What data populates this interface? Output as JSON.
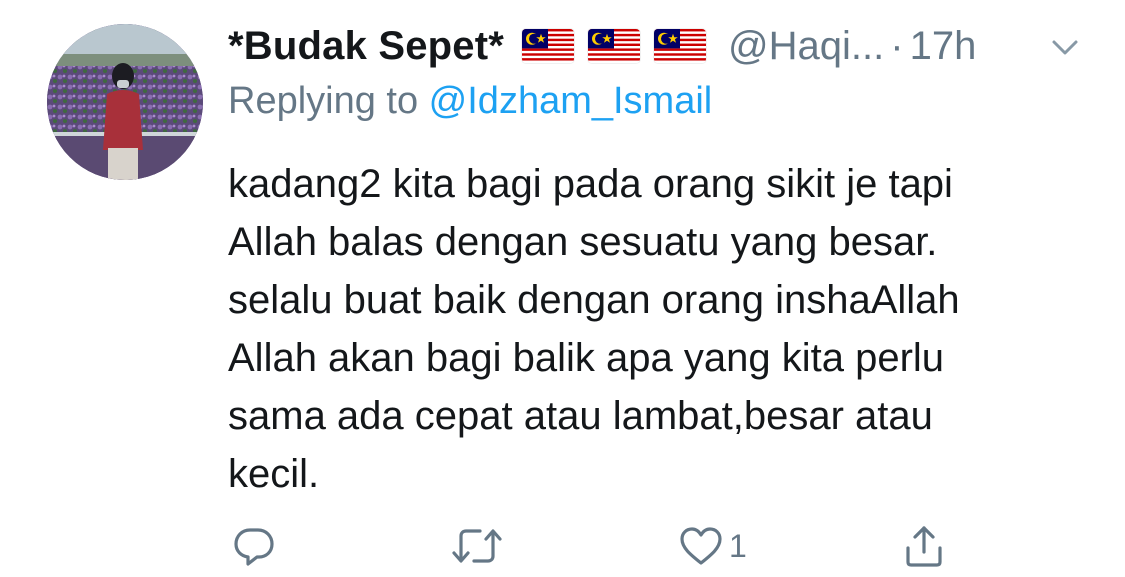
{
  "tweet": {
    "display_name": "*Budak Sepet*",
    "handle": "@Haqi...",
    "separator": "·",
    "time": "17h",
    "replying_prefix": "Replying to ",
    "replying_to": "@Idzham_Ismail",
    "body_lines": [
      "kadang2 kita bagi pada orang sikit je tapi",
      "Allah balas dengan sesuatu yang besar.",
      "selalu buat baik dengan orang inshaAllah",
      "Allah akan bagi balik apa yang kita perlu",
      "sama ada cepat atau lambat,besar atau",
      "kecil."
    ],
    "flags": [
      "malaysia-flag-icon",
      "malaysia-flag-icon",
      "malaysia-flag-icon"
    ],
    "actions": {
      "reply_icon": "reply-icon",
      "retweet_icon": "retweet-icon",
      "like_icon": "heart-icon",
      "like_count": "1",
      "share_icon": "share-icon"
    }
  },
  "colors": {
    "text": "#14171a",
    "secondary": "#657786",
    "link": "#1da1f2"
  }
}
